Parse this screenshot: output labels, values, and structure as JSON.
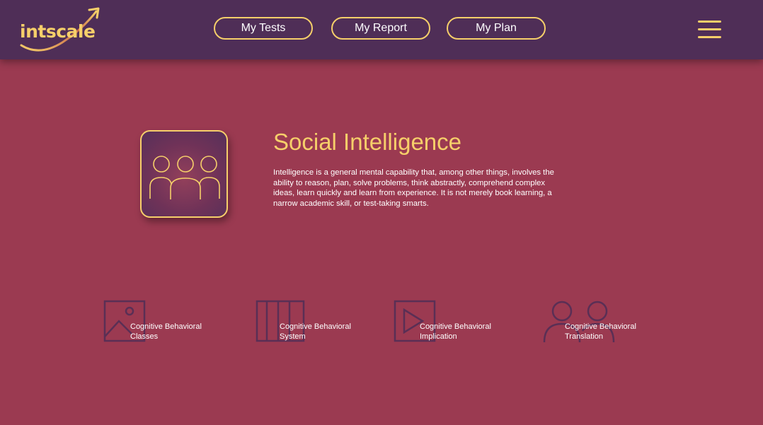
{
  "header": {
    "logo_text": "intscale",
    "nav": [
      {
        "label": "My Tests"
      },
      {
        "label": "My Report"
      },
      {
        "label": "My Plan"
      }
    ],
    "menu_icon": "hamburger-menu-icon"
  },
  "hero": {
    "icon": "group-of-people-icon",
    "title": "Social Intelligence",
    "description": "Intelligence is a general mental capability that, among other things, involves the ability to reason, plan, solve problems, think abstractly, comprehend complex ideas, learn quickly and learn from experience. It is not merely book learning, a narrow academic skill, or test-taking smarts."
  },
  "features": [
    {
      "icon": "image-icon",
      "line1": "Cognitive  Behavioral",
      "line2": "Classes"
    },
    {
      "icon": "columns-icon",
      "line1": "Cognitive Behavioral",
      "line2": "System"
    },
    {
      "icon": "play-icon",
      "line1": "Cognitive Behavioral",
      "line2": "Implication"
    },
    {
      "icon": "two-people-icon",
      "line1": "Cognitive Behavioral",
      "line2": "Translation"
    }
  ],
  "colors": {
    "background": "#9b3a51",
    "header": "#4f2e57",
    "accent": "#f6cf6a",
    "icon_stroke": "#5a2f55"
  }
}
